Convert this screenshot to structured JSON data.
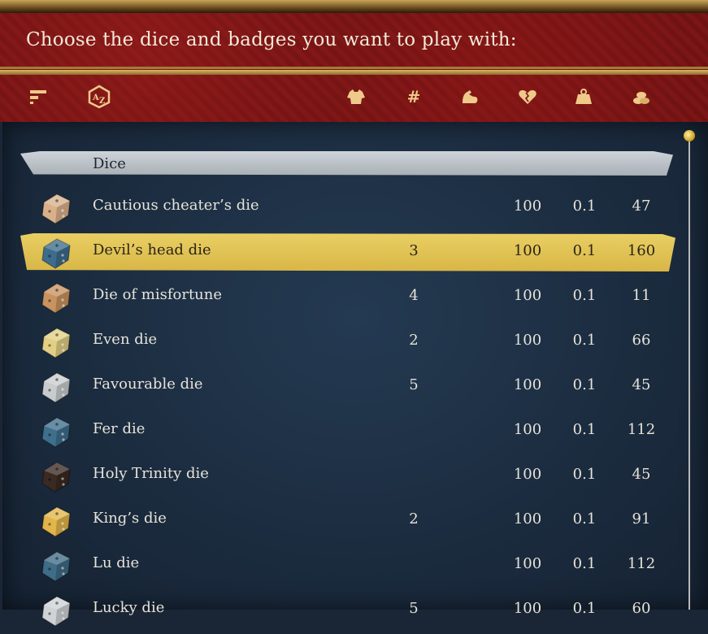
{
  "header": {
    "title": "Choose the dice and badges you want to play with:",
    "columns": [
      {
        "icon": "sort-bars-icon",
        "glyph": "≡"
      },
      {
        "icon": "alphabetical-sort-icon",
        "glyph": "AZ"
      },
      {
        "icon": "shirt-icon",
        "glyph": "👕"
      },
      {
        "icon": "hash-count-icon",
        "glyph": "#"
      },
      {
        "icon": "strength-arm-icon",
        "glyph": "💪"
      },
      {
        "icon": "health-heart-icon",
        "glyph": "❤"
      },
      {
        "icon": "weight-icon",
        "glyph": "⚖"
      },
      {
        "icon": "coins-icon",
        "glyph": "◎"
      }
    ]
  },
  "section": {
    "label": "Dice"
  },
  "rows": [
    {
      "name": "Cautious cheater’s die",
      "count": "",
      "a": "100",
      "b": "0.1",
      "c": "47",
      "color": "#d9b08a",
      "selected": false
    },
    {
      "name": "Devil’s head die",
      "count": "3",
      "a": "100",
      "b": "0.1",
      "c": "160",
      "color": "#3d6c8c",
      "selected": true
    },
    {
      "name": "Die of misfortune",
      "count": "4",
      "a": "100",
      "b": "0.1",
      "c": "11",
      "color": "#c8935f",
      "selected": false
    },
    {
      "name": "Even die",
      "count": "2",
      "a": "100",
      "b": "0.1",
      "c": "66",
      "color": "#e2cf84",
      "selected": false
    },
    {
      "name": "Favourable die",
      "count": "5",
      "a": "100",
      "b": "0.1",
      "c": "45",
      "color": "#c9ccce",
      "selected": false
    },
    {
      "name": "Fer die",
      "count": "",
      "a": "100",
      "b": "0.1",
      "c": "112",
      "color": "#3e6f8d",
      "selected": false
    },
    {
      "name": "Holy Trinity die",
      "count": "",
      "a": "100",
      "b": "0.1",
      "c": "45",
      "color": "#3a2a22",
      "selected": false
    },
    {
      "name": "King’s die",
      "count": "2",
      "a": "100",
      "b": "0.1",
      "c": "91",
      "color": "#e2b54a",
      "selected": false
    },
    {
      "name": "Lu die",
      "count": "",
      "a": "100",
      "b": "0.1",
      "c": "112",
      "color": "#3f6c86",
      "selected": false
    },
    {
      "name": "Lucky die",
      "count": "5",
      "a": "100",
      "b": "0.1",
      "c": "60",
      "color": "#cfd3d6",
      "selected": false
    }
  ]
}
